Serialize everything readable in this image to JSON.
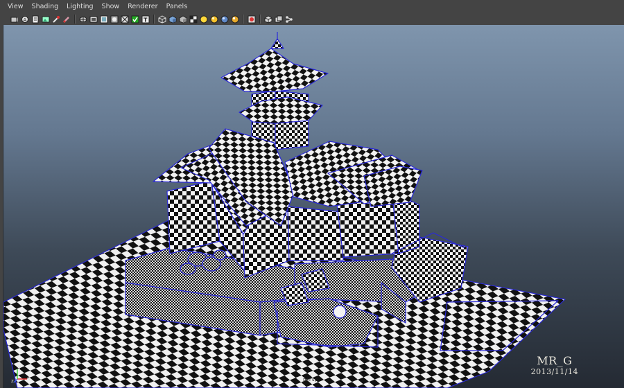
{
  "menu": {
    "items": [
      "View",
      "Shading",
      "Lighting",
      "Show",
      "Renderer",
      "Panels"
    ]
  },
  "toolbar": {
    "groups": [
      [
        "camera-select-icon",
        "camera-attributes-icon",
        "bookmarks-icon",
        "image-plane-icon",
        "2d-pan-zoom-icon",
        "grease-pencil-icon"
      ],
      [
        "grid-icon",
        "film-gate-icon",
        "resolution-gate-icon",
        "gate-mask-icon",
        "field-chart-icon",
        "safe-action-icon",
        "safe-title-icon"
      ],
      [
        "wireframe-icon",
        "smooth-shade-icon",
        "use-default-material-icon",
        "wireframe-on-shaded-icon",
        "xray-icon",
        "default-lighting-icon",
        "all-lights-icon",
        "shadows-icon"
      ],
      [
        "isolate-select-icon",
        "isolate-view-icon",
        "texture-display-icon"
      ]
    ]
  },
  "viewport": {
    "axes": [
      "x",
      "y",
      "z"
    ],
    "camera": "persp"
  },
  "watermark": {
    "name": "MR_G",
    "date": "2013/11/14"
  }
}
